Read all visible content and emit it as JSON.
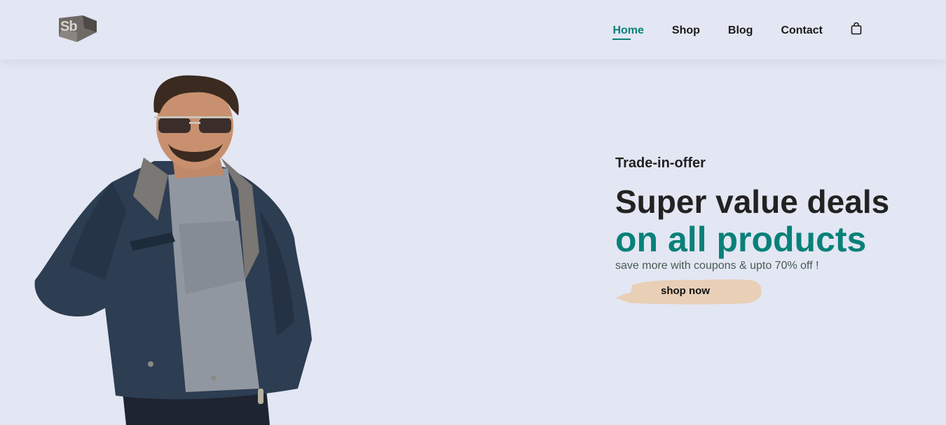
{
  "header": {
    "logo_text": "Sb",
    "nav": [
      {
        "label": "Home",
        "active": true
      },
      {
        "label": "Shop",
        "active": false
      },
      {
        "label": "Blog",
        "active": false
      },
      {
        "label": "Contact",
        "active": false
      }
    ],
    "cart_icon": "shopping-bag-icon"
  },
  "hero": {
    "kicker": "Trade-in-offer",
    "headline": "Super value deals",
    "highlight": "on all products",
    "subtext": "save more with coupons & upto 70% off !",
    "button_label": "shop now",
    "image": "man-in-jacket-photo"
  },
  "colors": {
    "background": "#e3e6f3",
    "accent": "#088178",
    "button_brush": "#e8cfb6",
    "text": "#222222"
  }
}
